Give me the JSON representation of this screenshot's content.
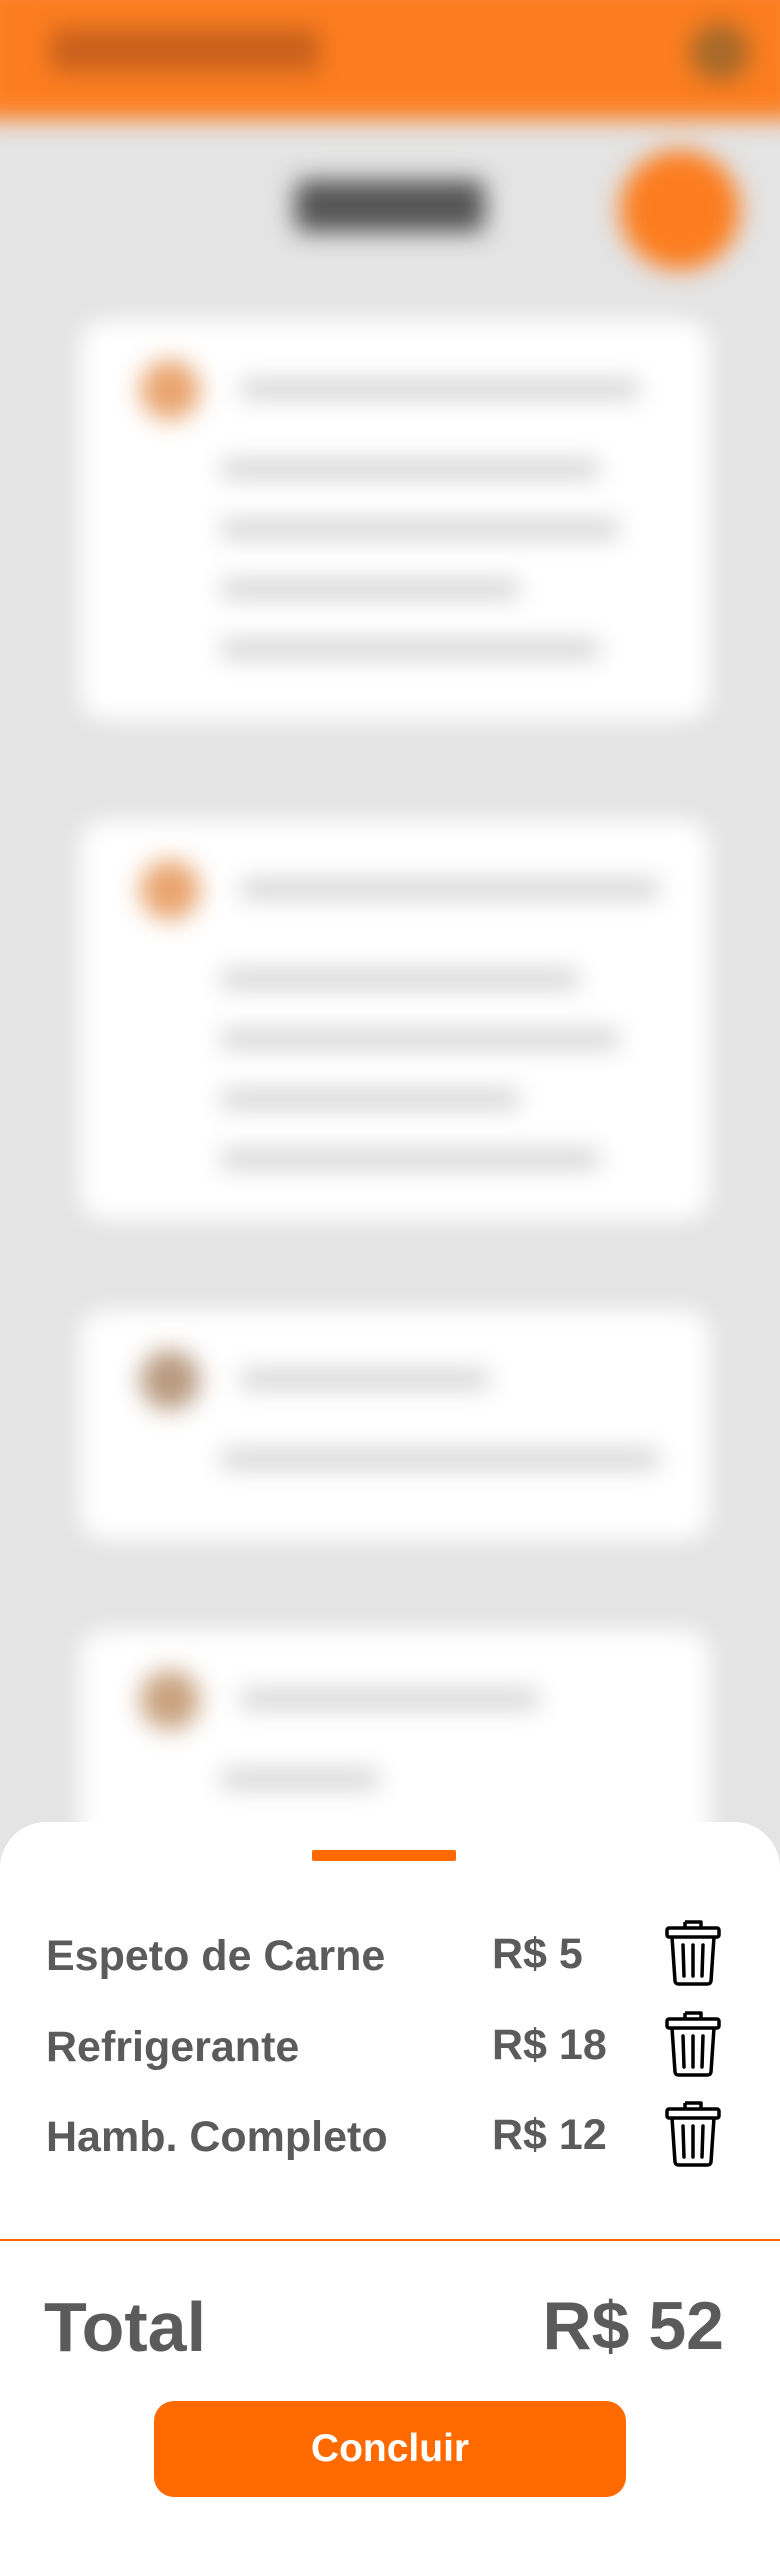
{
  "theme": {
    "accent": "#ff6a00",
    "header_color": "#fc7d1f",
    "text_color": "#5b5b5b"
  },
  "cart": {
    "items": [
      {
        "name": "Espeto de Carne",
        "price": "R$ 5",
        "remove_icon": "trash-icon"
      },
      {
        "name": "Refrigerante",
        "price": "R$ 18",
        "remove_icon": "trash-icon"
      },
      {
        "name": "Hamb. Completo",
        "price": "R$ 12",
        "remove_icon": "trash-icon"
      }
    ],
    "total_label": "Total",
    "total_value": "R$ 52",
    "confirm_label": "Concluir"
  }
}
